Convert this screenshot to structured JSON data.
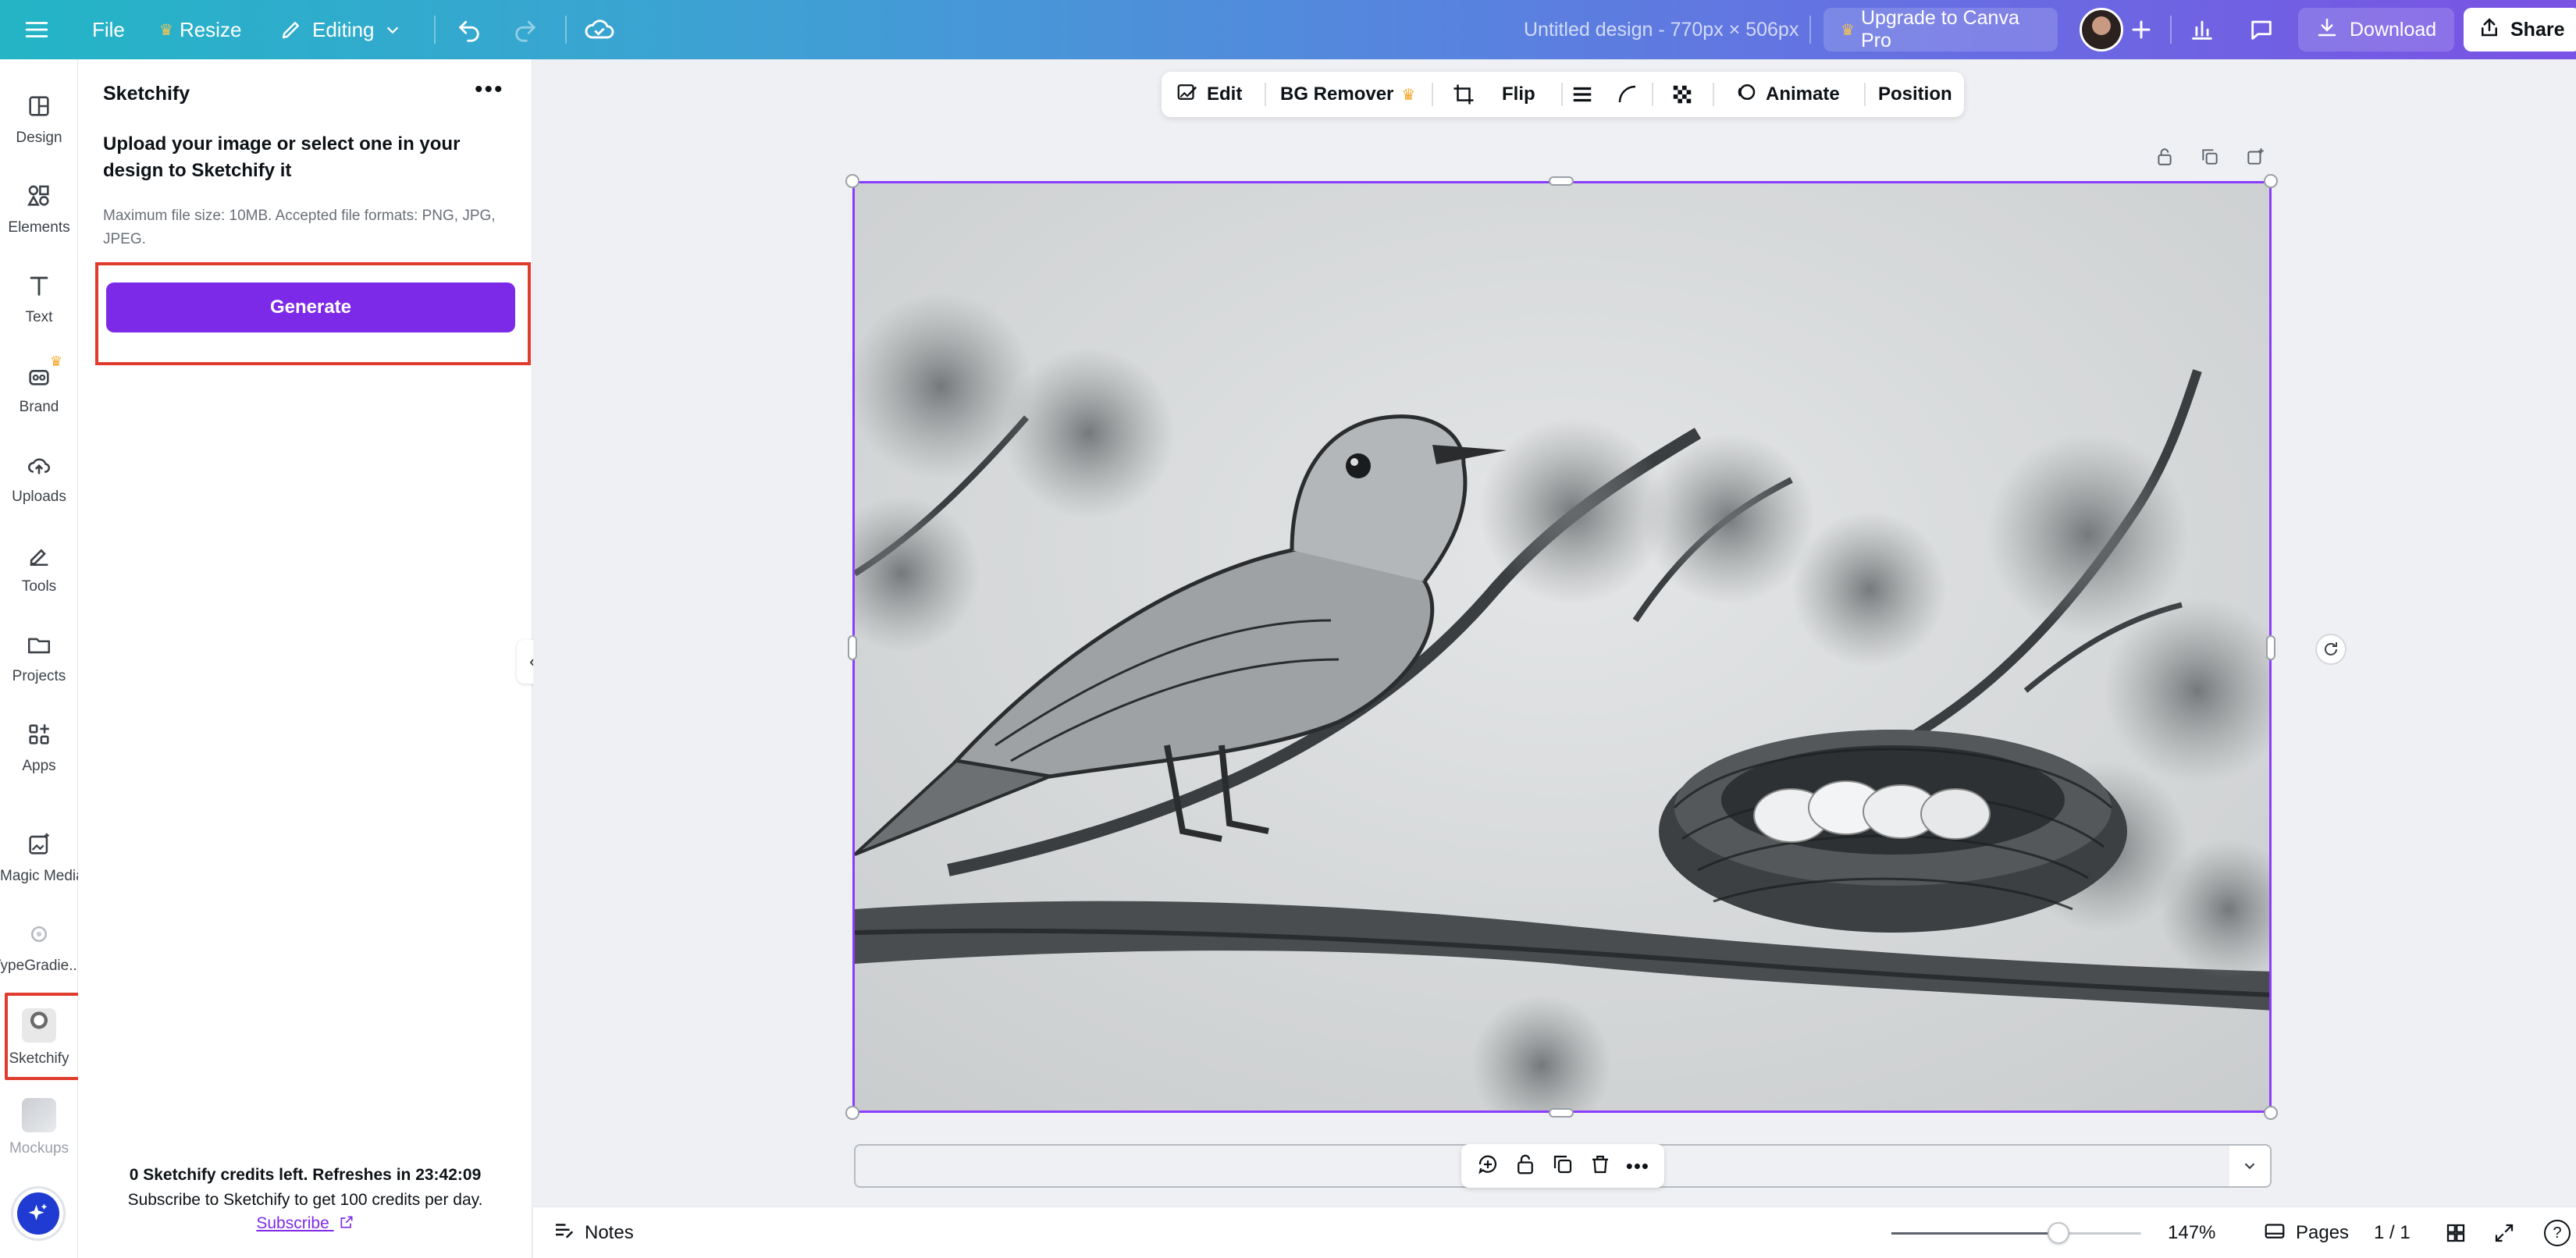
{
  "topbar": {
    "file_label": "File",
    "resize_label": "Resize",
    "editing_label": "Editing",
    "design_title": "Untitled design - 770px × 506px",
    "upgrade_label": "Upgrade to Canva Pro",
    "download_label": "Download",
    "share_label": "Share",
    "brand_gradient": [
      "#23b5c6",
      "#7a52e4"
    ]
  },
  "rail": {
    "items": [
      {
        "label": "Design",
        "icon": "layout-icon"
      },
      {
        "label": "Elements",
        "icon": "shapes-icon"
      },
      {
        "label": "Text",
        "icon": "text-icon"
      },
      {
        "label": "Brand",
        "icon": "brand-icon"
      },
      {
        "label": "Uploads",
        "icon": "cloud-upload-icon"
      },
      {
        "label": "Tools",
        "icon": "pen-icon"
      },
      {
        "label": "Projects",
        "icon": "folder-icon"
      },
      {
        "label": "Apps",
        "icon": "apps-icon"
      },
      {
        "label": "Magic Media",
        "icon": "magic-media-icon"
      },
      {
        "label": "TypeGradie...",
        "icon": "typegradient-icon"
      },
      {
        "label": "Sketchify",
        "icon": "sketchify-icon"
      },
      {
        "label": "Mockups",
        "icon": "mockups-icon"
      }
    ]
  },
  "panel": {
    "title": "Sketchify",
    "description": "Upload your image or select one in your design to Sketchify it",
    "file_note": "Maximum file size: 10MB. Accepted file formats: PNG, JPG, JPEG.",
    "generate_label": "Generate",
    "credits_text": "0 Sketchify credits left. Refreshes in  23:42:09",
    "subscribe_text": "Subscribe to Sketchify to get 100 credits per day.",
    "subscribe_link": "Subscribe",
    "accent": "#7d2ae8"
  },
  "context_toolbar": {
    "edit_label": "Edit",
    "bg_remover_label": "BG Remover",
    "flip_label": "Flip",
    "animate_label": "Animate",
    "position_label": "Position"
  },
  "bottombar": {
    "notes_label": "Notes",
    "zoom_label": "147%",
    "zoom_level_fraction": 0.67,
    "pages_label": "Pages",
    "page_count": "1 / 1",
    "help_label": "?"
  }
}
